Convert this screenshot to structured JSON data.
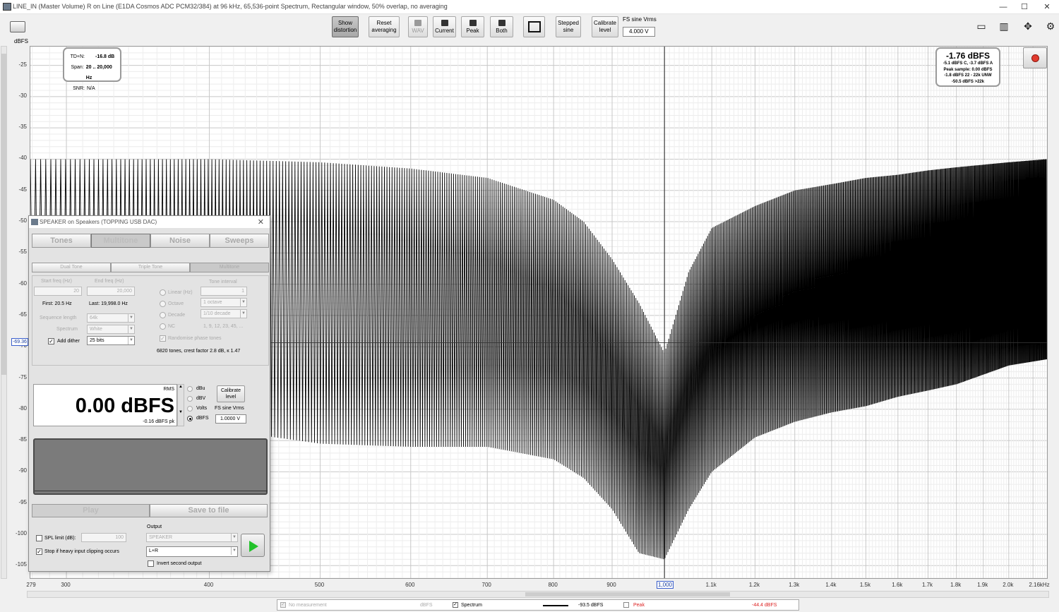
{
  "window": {
    "title": "LINE_IN (Master Volume) R on Line (E1DA Cosmos ADC PCM32/384) at 96 kHz, 65,536-point Spectrum, Rectangular window, 50% overlap, no averaging",
    "minimize": "—",
    "maximize": "☐",
    "close": "✕"
  },
  "toolbar": {
    "show_distortion": "Show distortion",
    "reset_averaging": "Reset averaging",
    "wav": "WAV",
    "current": "Current",
    "peak": "Peak",
    "both": "Both",
    "stepped_sine": "Stepped sine",
    "calibrate_level": "Calibrate level",
    "fs_sine_label": "FS sine Vrms",
    "fs_sine_value": "4.000 V"
  },
  "graph": {
    "y_unit": "dBFS",
    "y_ticks": [
      "-25",
      "-30",
      "-35",
      "-40",
      "-45",
      "-50",
      "-55",
      "-60",
      "-65",
      "-70",
      "-75",
      "-80",
      "-85",
      "-90",
      "-95",
      "-100",
      "-105"
    ],
    "x_ticks": [
      "279",
      "300",
      "400",
      "500",
      "600",
      "700",
      "800",
      "900",
      "1.1k",
      "1.2k",
      "1.3k",
      "1.4k",
      "1.5k",
      "1.6k",
      "1.7k",
      "1.8k",
      "1.9k",
      "2.0k",
      "2.16kHz"
    ],
    "cursor_x": "1,000",
    "cursor_y": "-69.36",
    "accent_color": "#3a5fcd"
  },
  "chart_data": {
    "type": "line",
    "title": "",
    "xlabel": "",
    "ylabel": "dBFS",
    "x_scale": "log",
    "xlim": [
      279,
      2160
    ],
    "ylim": [
      -107,
      -22
    ],
    "grid": true,
    "series": [
      {
        "name": "Spectrum",
        "x": [
          279,
          300,
          400,
          500,
          600,
          700,
          800,
          850,
          900,
          950,
          1000,
          1050,
          1100,
          1200,
          1300,
          1400,
          1500,
          1600,
          1700,
          1800,
          2000,
          2160
        ],
        "peak_envelope": [
          -40,
          -40,
          -40,
          -40.5,
          -41.5,
          -43,
          -46.5,
          -50,
          -56,
          -63,
          -71,
          -58,
          -51,
          -47.5,
          -45,
          -44,
          -43,
          -42.5,
          -41.8,
          -41.3,
          -40.5,
          -40
        ],
        "floor_envelope": [
          -74,
          -77,
          -83,
          -85.5,
          -86,
          -86,
          -88,
          -91,
          -96,
          -103,
          -104,
          -96,
          -90,
          -84.5,
          -82,
          -80.5,
          -79.5,
          -78,
          -77,
          -76,
          -73,
          -72
        ]
      }
    ]
  },
  "tdn_box": {
    "tdn_label": "TD+N:",
    "tdn_value": "-16.8 dB",
    "span_label": "Span:",
    "span_value": "20 .. 20,000 Hz",
    "snr_label": "SNR:",
    "snr_value": "N/A"
  },
  "level_box": {
    "main": "-1.76 dBFS",
    "line1": "-5.1 dBFS C, -3.7 dBFS A",
    "line2": "Peak sample: 0.00 dBFS",
    "line3": "-1.8 dBFS 22 - 22k UNW",
    "line4": "-50.5 dBFS >22k"
  },
  "generator": {
    "title": "SPEAKER on Speakers (TOPPING USB DAC)",
    "tabs": [
      "Tones",
      "Multitone",
      "Noise",
      "Sweeps"
    ],
    "subtabs": [
      "Dual Tone",
      "Triple Tone",
      "Multitone"
    ],
    "start_freq_label": "Start freq (Hz)",
    "start_freq_value": "20",
    "end_freq_label": "End freq (Hz)",
    "end_freq_value": "20,000",
    "first": "First: 20.5 Hz",
    "last": "Last: 19,998.0 Hz",
    "seq_length_label": "Sequence length",
    "seq_length_value": "64k",
    "spectrum_label": "Spectrum",
    "spectrum_value": "White",
    "add_dither": "Add dither",
    "dither_bits": "25 bits",
    "linear_label": "Linear (Hz)",
    "octave_label": "Octave",
    "decade_label": "Decade",
    "nc_label": "NC",
    "tone_interval_label": "Tone interval",
    "tone_interval_value": "1",
    "octave_value": "1 octave",
    "decade_value": "1/10 decade",
    "nc_value": "1, 9, 12, 23, 45, ...",
    "randomise": "Randomise phase tones",
    "tones_info": "6820 tones, crest factor 2.8 dB, κ 1.47",
    "meter_rms": "RMS",
    "meter_value": "0.00 dBFS",
    "meter_pk": "-0.16 dBFS pk",
    "unit_dbu": "dBu",
    "unit_dbv": "dBV",
    "unit_volts": "Volts",
    "unit_dbfs": "dBFS",
    "calibrate": "Calibrate level",
    "fs_sine_label": "FS sine Vrms",
    "fs_sine_value": "1.0000 V",
    "play": "Play",
    "save": "Save to file",
    "spl_limit": "SPL limit (dB):",
    "spl_value": "100",
    "stop_clip": "Stop if heavy input clipping occurs",
    "output_label": "Output",
    "output_device": "SPEAKER",
    "output_channel": "L+R",
    "invert": "Invert second output"
  },
  "statusbar": {
    "no_measurement": "No measurement",
    "no_meas_unit": "dBFS",
    "spectrum": "Spectrum",
    "spectrum_value": "-93.5 dBFS",
    "peak": "Peak",
    "peak_value": "-44.4 dBFS"
  }
}
